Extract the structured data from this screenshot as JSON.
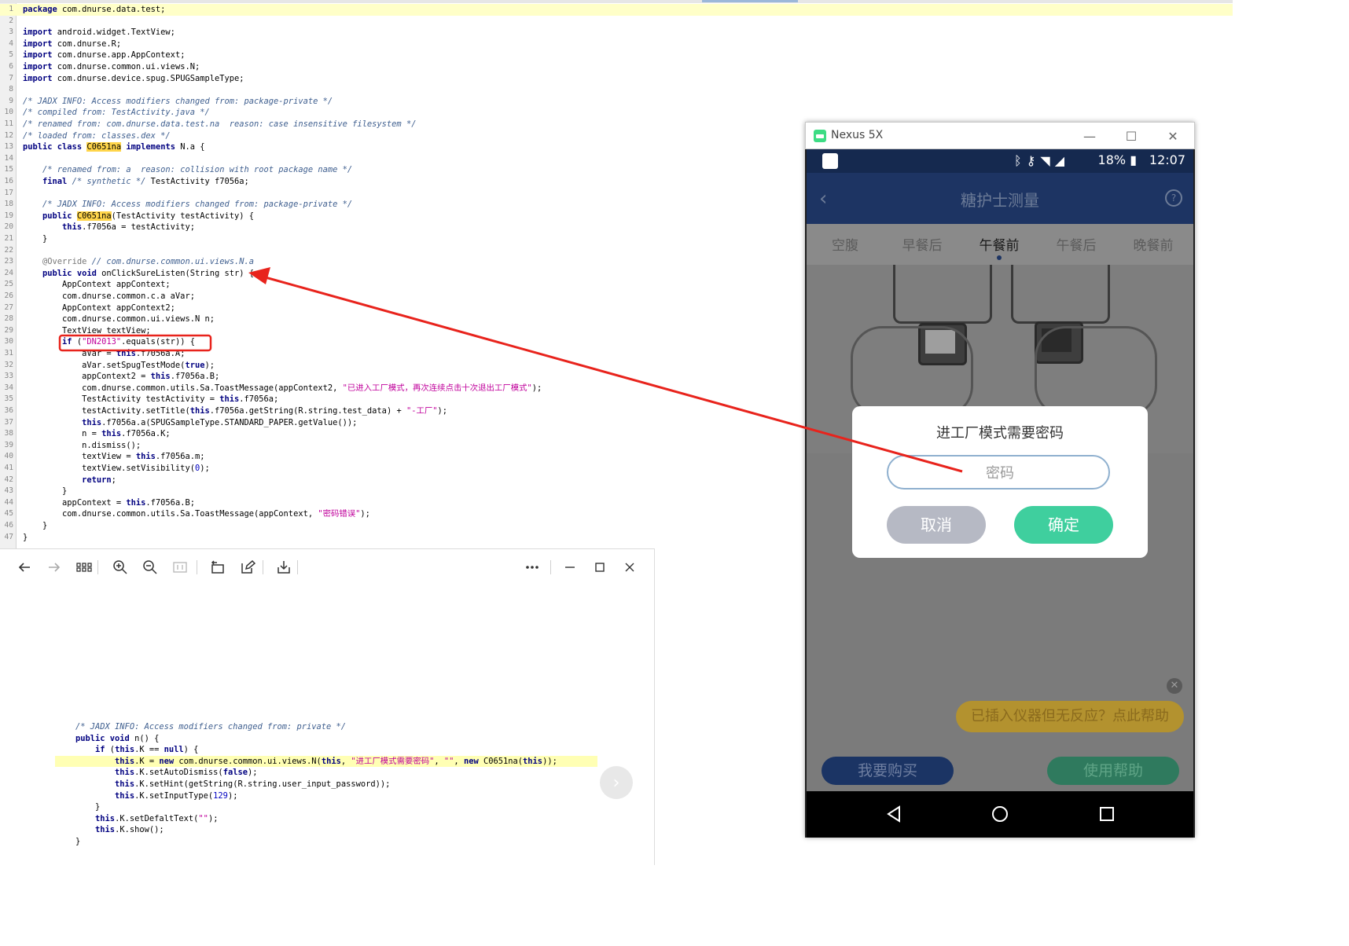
{
  "editor": {
    "lines": [
      {
        "n": "1",
        "hl": true,
        "html": "<span class=\"kw\">package</span> com.dnurse.data.test;"
      },
      {
        "n": "2",
        "html": ""
      },
      {
        "n": "3",
        "html": "<span class=\"kw\">import</span> android.widget.TextView;"
      },
      {
        "n": "4",
        "html": "<span class=\"kw\">import</span> com.dnurse.R;"
      },
      {
        "n": "5",
        "html": "<span class=\"kw\">import</span> com.dnurse.app.AppContext;"
      },
      {
        "n": "6",
        "html": "<span class=\"kw\">import</span> com.dnurse.common.ui.views.N;"
      },
      {
        "n": "7",
        "html": "<span class=\"kw\">import</span> com.dnurse.device.spug.SPUGSampleType;"
      },
      {
        "n": "8",
        "html": ""
      },
      {
        "n": "9",
        "html": "<span class=\"cm\">/* JADX INFO: Access modifiers changed from: package-private */</span>"
      },
      {
        "n": "10",
        "html": "<span class=\"cm\">/* compiled from: TestActivity.java */</span>"
      },
      {
        "n": "11",
        "html": "<span class=\"cm\">/* renamed from: com.dnurse.data.test.na  reason: case insensitive filesystem */</span>"
      },
      {
        "n": "12",
        "html": "<span class=\"cm\">/* loaded from: classes.dex */</span>"
      },
      {
        "n": "13",
        "html": "<span class=\"kw\">public class</span> <span class=\"mark\">C0651na</span> <span class=\"kw\">implements</span> N.a {"
      },
      {
        "n": "14",
        "html": ""
      },
      {
        "n": "15",
        "html": "    <span class=\"cm\">/* renamed from: a  reason: collision with root package name */</span>"
      },
      {
        "n": "16",
        "html": "    <span class=\"kw\">final</span> <span class=\"cm\">/* synthetic */</span> TestActivity f7056a;"
      },
      {
        "n": "17",
        "html": ""
      },
      {
        "n": "18",
        "html": "    <span class=\"cm\">/* JADX INFO: Access modifiers changed from: package-private */</span>"
      },
      {
        "n": "19",
        "html": "    <span class=\"kw\">public</span> <span class=\"mark\">C0651na</span>(TestActivity testActivity) {"
      },
      {
        "n": "20",
        "html": "        <span class=\"kw\">this</span>.f7056a = testActivity;"
      },
      {
        "n": "21",
        "html": "    }"
      },
      {
        "n": "22",
        "html": ""
      },
      {
        "n": "23",
        "html": "    <span class=\"an\">@Override</span> <span class=\"cm\">// com.dnurse.common.ui.views.N.a</span>"
      },
      {
        "n": "24",
        "html": "    <span class=\"kw\">public void</span> onClickSureListen(String str) {"
      },
      {
        "n": "25",
        "html": "        AppContext appContext;"
      },
      {
        "n": "26",
        "html": "        com.dnurse.common.c.a aVar;"
      },
      {
        "n": "27",
        "html": "        AppContext appContext2;"
      },
      {
        "n": "28",
        "html": "        com.dnurse.common.ui.views.N n;"
      },
      {
        "n": "29",
        "html": "        TextView textView;"
      },
      {
        "n": "30",
        "html": "        <span class=\"kw\">if</span> (<span class=\"st\">\"DN2013\"</span>.equals(str)) {"
      },
      {
        "n": "31",
        "html": "            aVar = <span class=\"kw\">this</span>.f7056a.A;"
      },
      {
        "n": "32",
        "html": "            aVar.setSpugTestMode(<span class=\"kw\">true</span>);"
      },
      {
        "n": "33",
        "html": "            appContext2 = <span class=\"kw\">this</span>.f7056a.B;"
      },
      {
        "n": "34",
        "html": "            com.dnurse.common.utils.Sa.ToastMessage(appContext2, <span class=\"st\">\"已进入工厂模式，再次连续点击十次退出工厂模式\"</span>);"
      },
      {
        "n": "35",
        "html": "            TestActivity testActivity = <span class=\"kw\">this</span>.f7056a;"
      },
      {
        "n": "36",
        "html": "            testActivity.setTitle(<span class=\"kw\">this</span>.f7056a.getString(R.string.test_data) + <span class=\"st\">\"-工厂\"</span>);"
      },
      {
        "n": "37",
        "html": "            <span class=\"kw\">this</span>.f7056a.a(SPUGSampleType.STANDARD_PAPER.getValue());"
      },
      {
        "n": "38",
        "html": "            n = <span class=\"kw\">this</span>.f7056a.K;"
      },
      {
        "n": "39",
        "html": "            n.dismiss();"
      },
      {
        "n": "40",
        "html": "            textView = <span class=\"kw\">this</span>.f7056a.m;"
      },
      {
        "n": "41",
        "html": "            textView.setVisibility(<span class=\"num\">0</span>);"
      },
      {
        "n": "42",
        "html": "            <span class=\"kw\">return</span>;"
      },
      {
        "n": "43",
        "html": "        }"
      },
      {
        "n": "44",
        "html": "        appContext = <span class=\"kw\">this</span>.f7056a.B;"
      },
      {
        "n": "45",
        "html": "        com.dnurse.common.utils.Sa.ToastMessage(appContext, <span class=\"st\">\"密码错误\"</span>);"
      },
      {
        "n": "46",
        "html": "    }"
      },
      {
        "n": "47",
        "html": "}"
      }
    ]
  },
  "viewer": {
    "toolbar": [
      "back-arrow-icon",
      "forward-arrow-icon",
      "grid-view-icon",
      "zoom-in-icon",
      "zoom-out-icon",
      "fit-icon",
      "rotate-icon",
      "edit-icon",
      "save-icon",
      "more-icon",
      "minimize-icon",
      "maximize-icon",
      "close-icon"
    ],
    "lines": [
      {
        "hl": false,
        "html": "<span class=\"cm\">/* JADX INFO: Access modifiers changed from: private */</span>"
      },
      {
        "hl": false,
        "html": "<span class=\"kw\">public void</span> n() {"
      },
      {
        "hl": false,
        "html": "    <span class=\"kw\">if</span> (<span class=\"kw\">this</span>.K == <span class=\"kw\">null</span>) {"
      },
      {
        "hl": true,
        "html": "        <span class=\"kw\">this</span>.K = <span class=\"kw\">new</span> com.dnurse.common.ui.views.N(<span class=\"kw\">this</span>, <span class=\"st\">\"进工厂模式需要密码\"</span>, <span class=\"st\">\"\"</span>, <span class=\"kw\">new</span> C0651na(<span class=\"kw\">this</span>));"
      },
      {
        "hl": false,
        "html": "        <span class=\"kw\">this</span>.K.setAutoDismiss(<span class=\"kw\">false</span>);"
      },
      {
        "hl": false,
        "html": "        <span class=\"kw\">this</span>.K.setHint(getString(R.string.user_input_password));"
      },
      {
        "hl": false,
        "html": "        <span class=\"kw\">this</span>.K.setInputType(<span class=\"num\">129</span>);"
      },
      {
        "hl": false,
        "html": "    }"
      },
      {
        "hl": false,
        "html": "    <span class=\"kw\">this</span>.K.setDefaltText(<span class=\"st\">\"\"</span>);"
      },
      {
        "hl": false,
        "html": "    <span class=\"kw\">this</span>.K.show();"
      },
      {
        "hl": false,
        "html": "}"
      }
    ]
  },
  "emulator": {
    "window_title": "Nexus 5X",
    "status": {
      "battery": "18%",
      "time": "12:07"
    },
    "app_title": "糖护士测量",
    "tabs": [
      "空腹",
      "早餐后",
      "午餐前",
      "午餐后",
      "晚餐前"
    ],
    "active_tab": 2,
    "tooltip": "已插入仪器但无反应？点此帮助",
    "buy_button": "我要购买",
    "help_button": "使用帮助"
  },
  "dialog": {
    "title": "进工厂模式需要密码",
    "password_placeholder": "密码",
    "cancel": "取消",
    "confirm": "确定"
  },
  "colors": {
    "annotation_red": "#e8231c",
    "app_bar": "#1d3463",
    "confirm_green": "#3fcf9e",
    "cancel_gray": "#b6b9c4"
  }
}
